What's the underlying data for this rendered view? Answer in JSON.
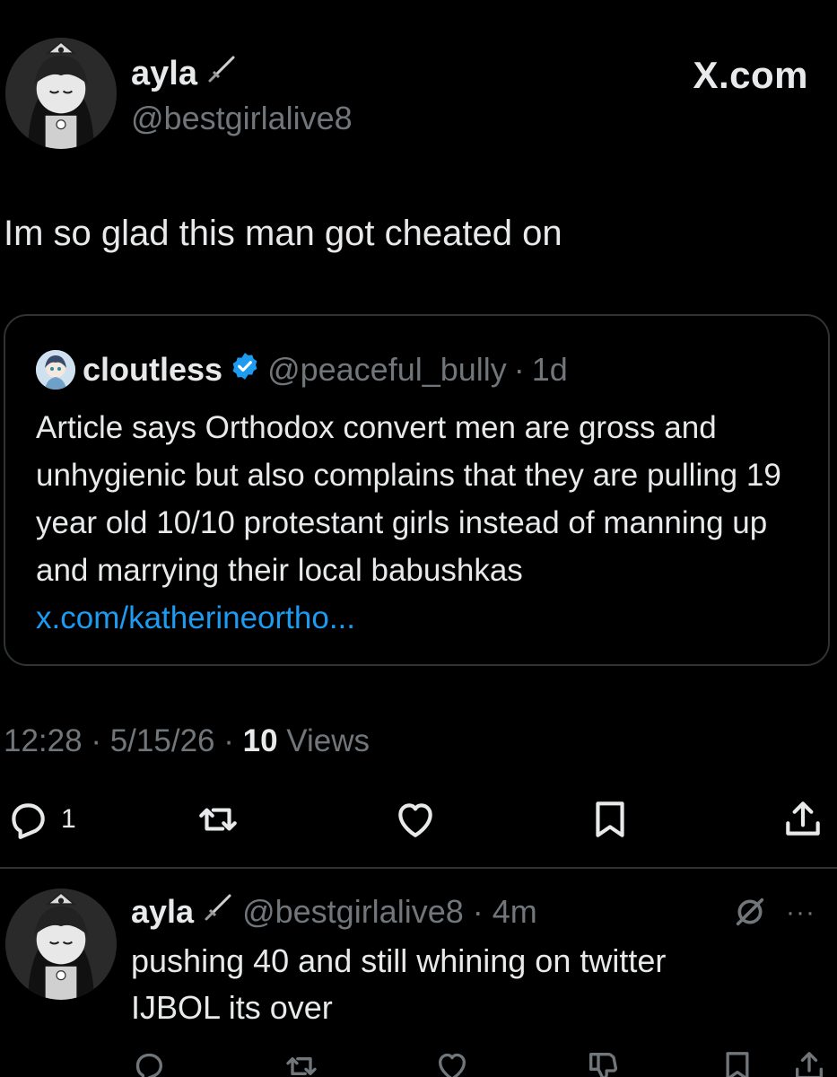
{
  "header": {
    "name": "ayla",
    "handle": "@bestgirlalive8",
    "brand": "X.com"
  },
  "tweet": {
    "text": "Im so glad this man got cheated on"
  },
  "quote": {
    "name": "cloutless",
    "handle": "@peaceful_bully",
    "separator": "·",
    "time": "1d",
    "text": "Article says Orthodox convert men are gross and unhygienic but also complains that they are pulling 19 year old 10/10 protestant girls instead of manning up and marrying their local babushkas ",
    "link": "x.com/katherineortho..."
  },
  "meta": {
    "time": "12:28",
    "date": "5/15/26",
    "sep": "·",
    "views_count": "10",
    "views_label": "Views"
  },
  "actions": {
    "reply_count": "1"
  },
  "reply": {
    "name": "ayla",
    "handle": "@bestgirlalive8",
    "sep": "·",
    "time": "4m",
    "more": "···",
    "text_line1": "pushing 40 and still whining on twitter",
    "text_line2": "IJBOL its over"
  },
  "colors": {
    "background": "#000000",
    "text": "#e7e9ea",
    "muted": "#71767b",
    "link": "#1d9bf0",
    "verified": "#1d9bf0",
    "border": "#2f3336"
  },
  "icons": [
    "sword-icon",
    "verified-badge-icon",
    "reply-icon",
    "retweet-icon",
    "like-icon",
    "bookmark-icon",
    "share-icon",
    "mute-icon",
    "more-icon"
  ]
}
